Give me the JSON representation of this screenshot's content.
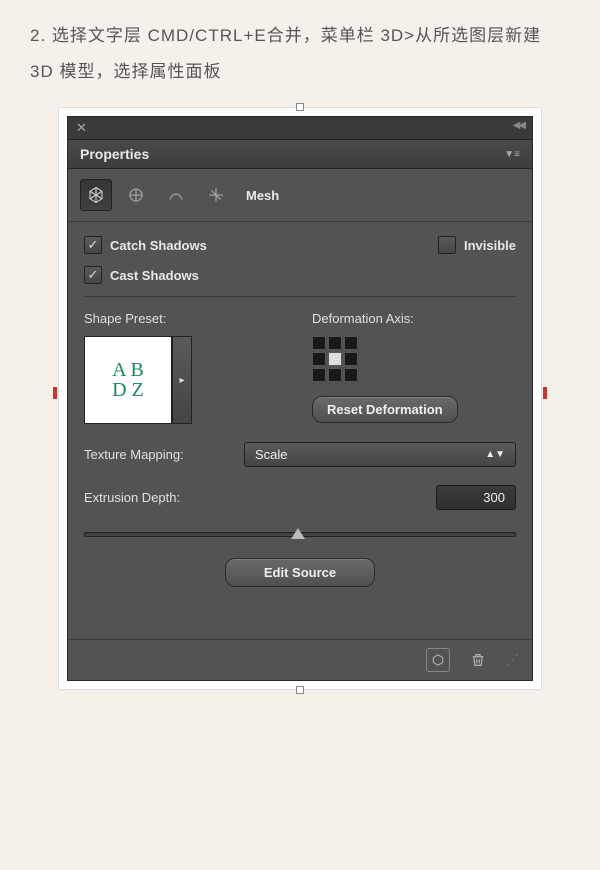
{
  "instruction": "2. 选择文字层 CMD/CTRL+E合并，菜单栏 3D>从所选图层新建 3D 模型，选择属性面板",
  "panel": {
    "title": "Properties",
    "tab_label": "Mesh",
    "catch_shadows": "Catch Shadows",
    "cast_shadows": "Cast Shadows",
    "invisible": "Invisible",
    "shape_preset_label": "Shape Preset:",
    "preset_text1": "A B",
    "preset_text2": "D Z",
    "deform_axis_label": "Deformation Axis:",
    "reset_deform": "Reset Deformation",
    "texture_mapping_label": "Texture Mapping:",
    "texture_mapping_value": "Scale",
    "extrusion_label": "Extrusion Depth:",
    "extrusion_value": "300",
    "edit_source": "Edit Source"
  }
}
